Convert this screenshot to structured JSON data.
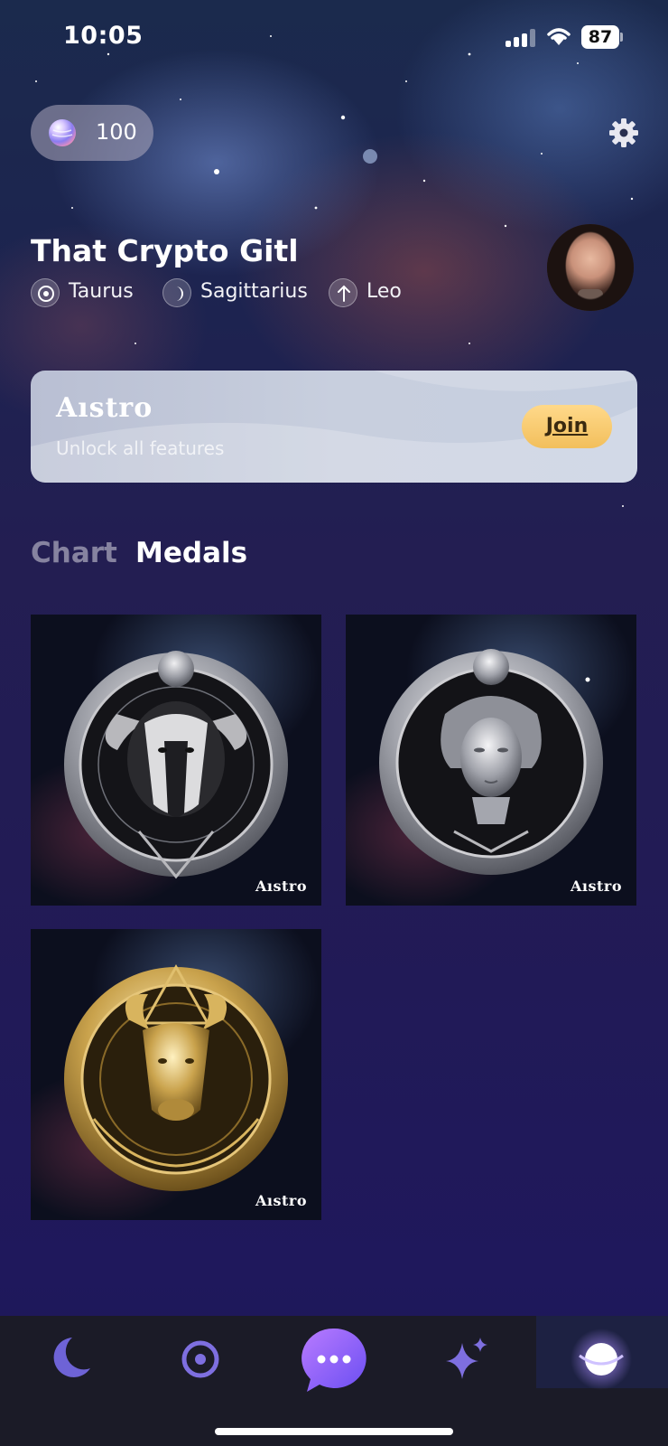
{
  "status_bar": {
    "time": "10:05",
    "battery": "87"
  },
  "header": {
    "coins": "100"
  },
  "profile": {
    "name": "That Crypto Gitl",
    "signs": [
      {
        "icon": "sun-sign-icon",
        "label": "Taurus"
      },
      {
        "icon": "moon-sign-icon",
        "label": "Sagittarius"
      },
      {
        "icon": "rising-sign-icon",
        "label": "Leo"
      }
    ]
  },
  "promo": {
    "brand": "Aıstro",
    "subtitle": "Unlock all features",
    "button_label": "Join"
  },
  "tabs": [
    {
      "label": "Chart",
      "active": false
    },
    {
      "label": "Medals",
      "active": true
    }
  ],
  "medals": [
    {
      "subject": "ram-medal",
      "tone": "silver",
      "brand": "Aıstro"
    },
    {
      "subject": "maiden-medal",
      "tone": "silver",
      "brand": "Aıstro"
    },
    {
      "subject": "bull-medal",
      "tone": "gold",
      "brand": "Aıstro"
    }
  ],
  "bottom_nav": [
    {
      "icon": "moon-icon",
      "active": false
    },
    {
      "icon": "target-icon",
      "active": false
    },
    {
      "icon": "chat-bubble-icon",
      "active": false
    },
    {
      "icon": "sparkles-icon",
      "active": false
    },
    {
      "icon": "planet-icon",
      "active": true
    }
  ],
  "colors": {
    "accent_gold": "#f2bf5c",
    "nav_bg": "#1b1b27",
    "chat_purple": "#9b5cf6"
  }
}
